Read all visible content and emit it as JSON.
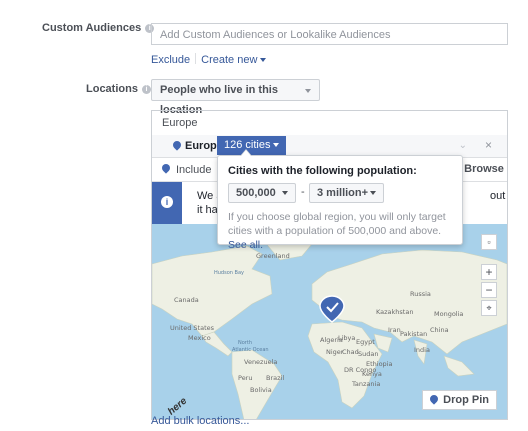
{
  "custom_audiences": {
    "label": "Custom Audiences",
    "placeholder": "Add Custom Audiences or Lookalike Audiences",
    "exclude_link": "Exclude",
    "create_new_link": "Create new"
  },
  "locations": {
    "label": "Locations",
    "mode_dropdown": "People who live in this location",
    "region_group_title": "Europe",
    "selected_region": "Europe",
    "cities_button": "126 cities",
    "include_dropdown": "Include",
    "browse_button": "Browse",
    "warning_start": "We a",
    "warning_line2": "it has",
    "warning_end": "out"
  },
  "popover": {
    "title": "Cities with the following population:",
    "min_population": "500,000",
    "separator": "-",
    "max_population": "3 million+",
    "note": "If you choose global region, you will only target cities with a population of 500,000 and above.",
    "see_all_link": "See all."
  },
  "map": {
    "labels": [
      "Canada",
      "United States",
      "Mexico",
      "North Atlantic Ocean",
      "Venezuela",
      "Brazil",
      "Peru",
      "Bolivia",
      "Russia",
      "Kazakhstan",
      "Mongolia",
      "China",
      "India",
      "Algeria",
      "Libya",
      "Niger",
      "Chad",
      "Sudan",
      "Egypt",
      "Iran",
      "Ethiopia",
      "DR Congo",
      "Kenya",
      "Tanzania",
      "Greenland",
      "Hudson Bay",
      "Pakistan"
    ],
    "logo": "here",
    "zoom_in": "+",
    "zoom_out": "−",
    "drop_pin_button": "Drop Pin"
  },
  "bulk_link": "Add bulk locations...",
  "colors": {
    "accent": "#4267b2",
    "link": "#365899",
    "ocean": "#a8d1ea",
    "land": "#eef0e4"
  }
}
